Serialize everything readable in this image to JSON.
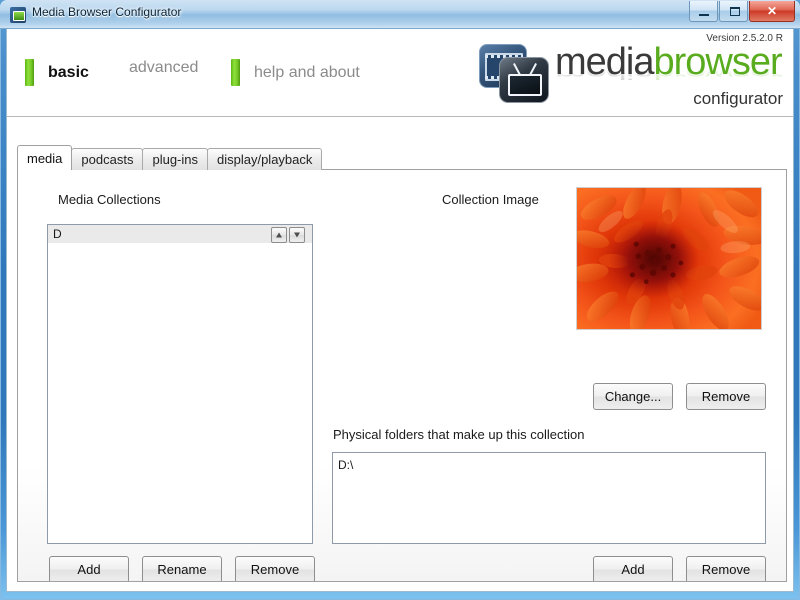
{
  "window": {
    "title": "Media Browser Configurator",
    "icon": "app-icon",
    "controls": {
      "minimize": "Minimize",
      "maximize": "Maximize",
      "close": "Close"
    }
  },
  "header": {
    "nav": [
      {
        "label": "basic",
        "active": true,
        "has_bar": true
      },
      {
        "label": "advanced",
        "active": false,
        "has_bar": false
      },
      {
        "label": "help and about",
        "active": false,
        "has_bar": true
      }
    ],
    "logo": {
      "word_primary": "media",
      "word_secondary": "browser",
      "subtitle": "configurator",
      "version": "Version 2.5.2.0 R",
      "color_primary": "#3a3a3a",
      "color_secondary": "#5aac1f"
    }
  },
  "tabs": [
    {
      "label": "media",
      "active": true
    },
    {
      "label": "podcasts",
      "active": false
    },
    {
      "label": "plug-ins",
      "active": false
    },
    {
      "label": "display/playback",
      "active": false
    }
  ],
  "panel": {
    "media_collections": {
      "label": "Media Collections",
      "items": [
        {
          "name": "D",
          "selected": true
        }
      ],
      "reorder": {
        "up": "move-up",
        "down": "move-down"
      },
      "buttons": [
        "Add",
        "Rename",
        "Remove"
      ]
    },
    "collection_image": {
      "label": "Collection Image",
      "image_alt": "orange chrysanthemum flower",
      "buttons": [
        "Change...",
        "Remove"
      ]
    },
    "physical_folders": {
      "label": "Physical folders that make up this collection",
      "items": [
        "D:\\"
      ],
      "buttons": [
        "Add",
        "Remove"
      ]
    }
  },
  "colors": {
    "accent_green": "#5aac1f",
    "titlebar_blue": "#2f78bc",
    "selection_gray": "#eaeaea"
  }
}
